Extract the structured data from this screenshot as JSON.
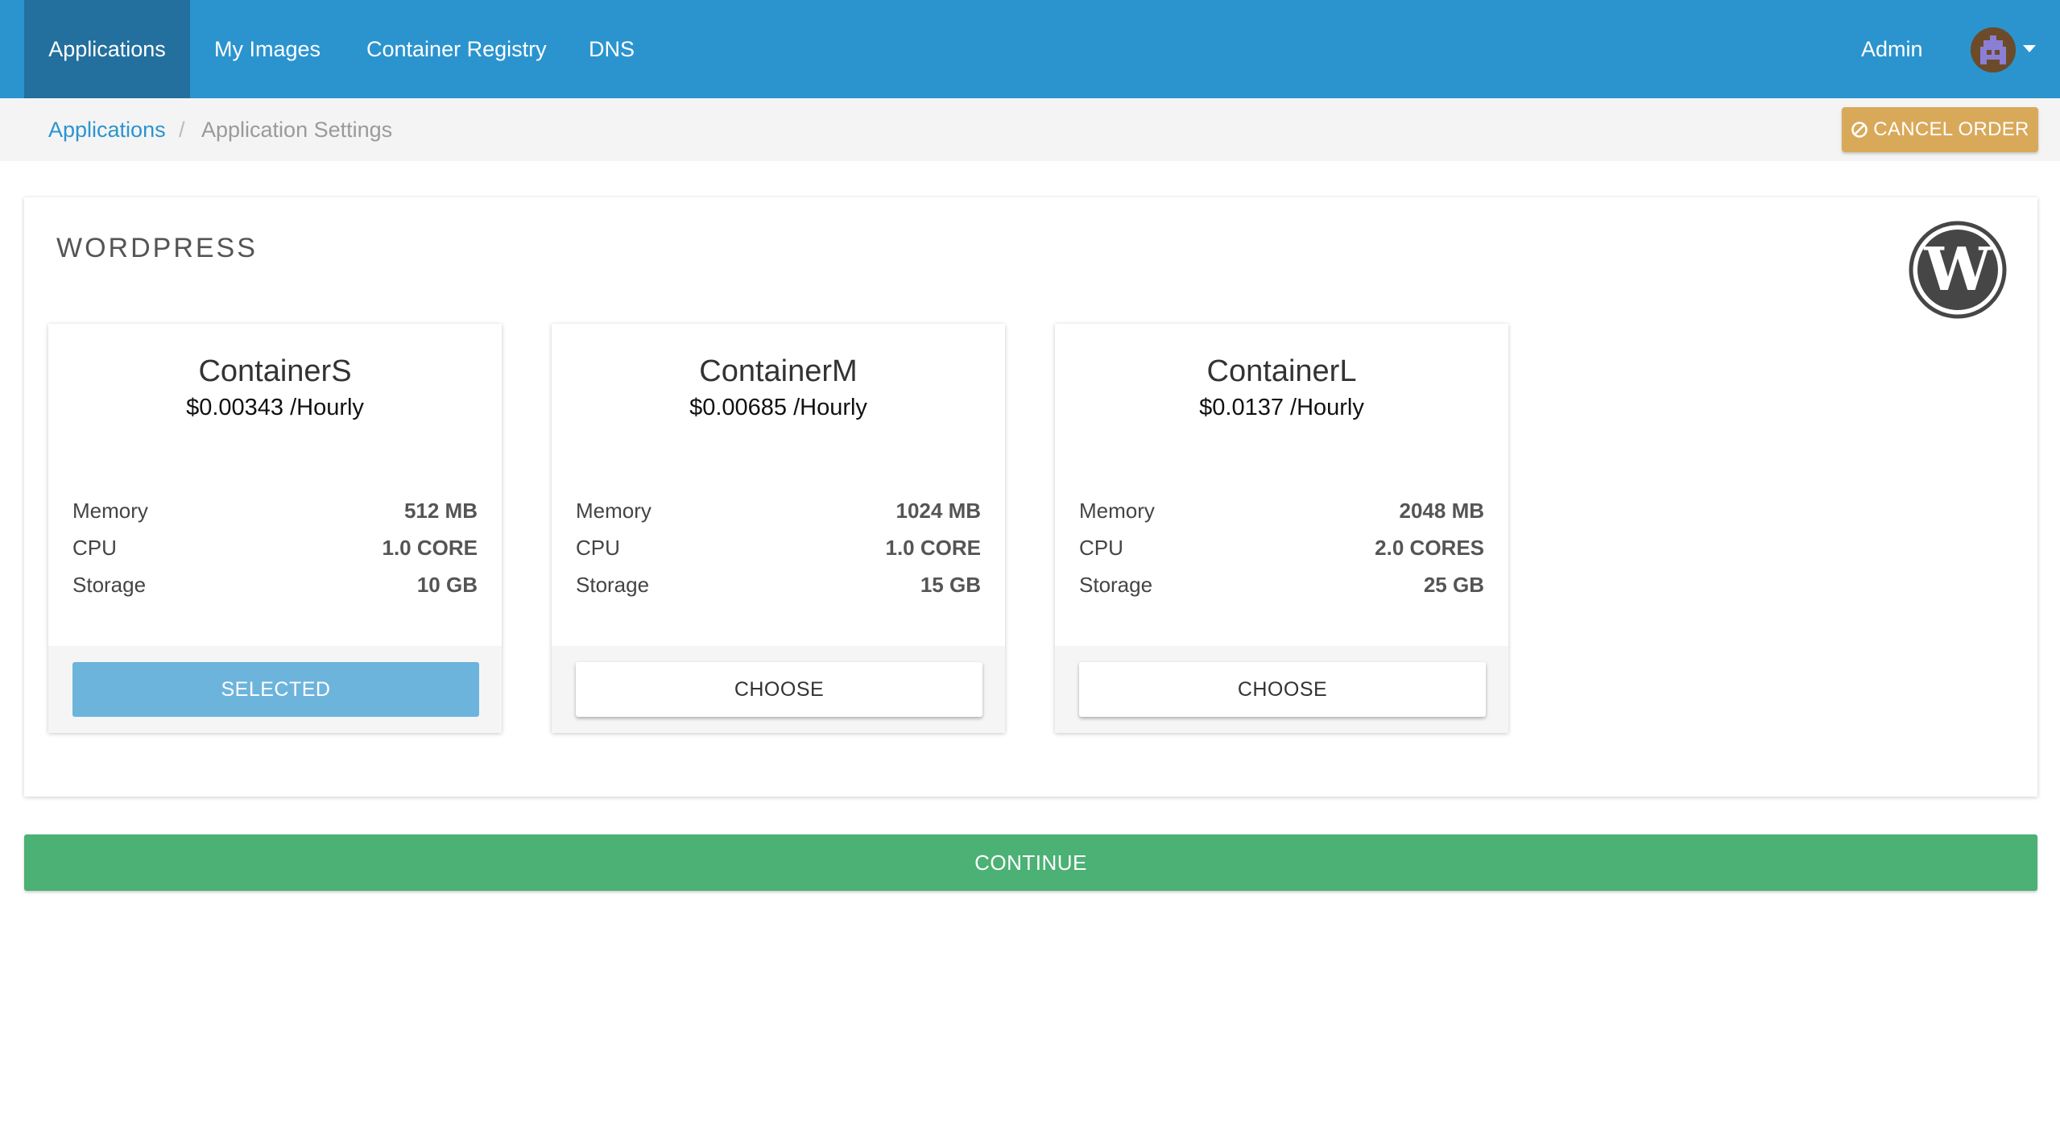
{
  "nav": {
    "items": [
      {
        "label": "Applications",
        "active": true
      },
      {
        "label": "My Images",
        "active": false
      },
      {
        "label": "Container Registry",
        "active": false
      },
      {
        "label": "DNS",
        "active": false
      }
    ],
    "user_label": "Admin",
    "avatar_icon": "pixel-avatar-icon",
    "menu_icon": "chevron-down-icon"
  },
  "breadcrumb": {
    "items": [
      {
        "label": "Applications",
        "link": true
      },
      {
        "label": "Application Settings",
        "link": false
      }
    ],
    "separator": "/"
  },
  "cancel_order": {
    "label": "CANCEL ORDER",
    "icon": "ban-icon",
    "color": "#d9a95a"
  },
  "app": {
    "title": "WORDPRESS",
    "logo_icon": "wordpress-logo-icon"
  },
  "plans": [
    {
      "name": "ContainerS",
      "price": "$0.00343 /Hourly",
      "specs": [
        {
          "label": "Memory",
          "value": "512 MB"
        },
        {
          "label": "CPU",
          "value": "1.0 CORE"
        },
        {
          "label": "Storage",
          "value": "10 GB"
        }
      ],
      "button": "SELECTED",
      "selected": true
    },
    {
      "name": "ContainerM",
      "price": "$0.00685 /Hourly",
      "specs": [
        {
          "label": "Memory",
          "value": "1024 MB"
        },
        {
          "label": "CPU",
          "value": "1.0 CORE"
        },
        {
          "label": "Storage",
          "value": "15 GB"
        }
      ],
      "button": "CHOOSE",
      "selected": false
    },
    {
      "name": "ContainerL",
      "price": "$0.0137 /Hourly",
      "specs": [
        {
          "label": "Memory",
          "value": "2048 MB"
        },
        {
          "label": "CPU",
          "value": "2.0 CORES"
        },
        {
          "label": "Storage",
          "value": "25 GB"
        }
      ],
      "button": "CHOOSE",
      "selected": false
    }
  ],
  "continue": {
    "label": "CONTINUE",
    "color": "#4cb174"
  },
  "colors": {
    "navbar": "#2b94ce",
    "navbar_active": "#236f9e",
    "link": "#2b94ce",
    "selected_button": "#6db4dc"
  }
}
